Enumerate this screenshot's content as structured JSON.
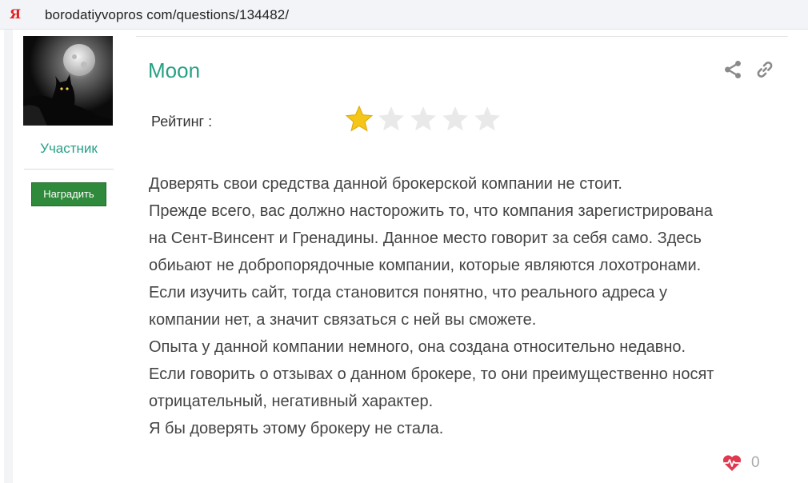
{
  "browser": {
    "url": "borodatiyvopros com/questions/134482/",
    "search_engine_icon": "yandex-y-icon",
    "search_engine_glyph": "Я"
  },
  "author": {
    "name": "Moon",
    "role": "Участник",
    "avatar": "moon-cat-avatar",
    "reward_label": "Наградить"
  },
  "actions": {
    "share_icon": "share-icon",
    "link_icon": "link-icon"
  },
  "rating": {
    "label": "Рейтинг :",
    "value": 1,
    "max": 5,
    "active_color": "#f5c518",
    "inactive_color": "#e9e9e9"
  },
  "post": {
    "lines": [
      "Доверять свои средства данной брокерской компании не стоит.",
      "Прежде всего, вас должно насторожить то, что компания зарегистрирована",
      "на Сент-Винсент и Гренадины. Данное место говорит за себя само. Здесь",
      "обиьают не добропорядочные компании, которые являются лохотронами.",
      "Если изучить сайт, тогда становится понятно, что реального адреса у",
      "компании нет, а значит связаться с ней вы сможете.",
      "Опыта у данной компании немного, она создана относительно недавно.",
      "Если говорить о отзывах о данном брокере, то они преимущественно носят",
      "отрицательный, негативный характер.",
      "Я бы доверять этому брокеру не стала."
    ]
  },
  "likes": {
    "icon": "heart-pulse-icon",
    "count": "0",
    "color": "#e0394f"
  },
  "colors": {
    "accent": "#26a085",
    "button": "#2f8a3c"
  }
}
